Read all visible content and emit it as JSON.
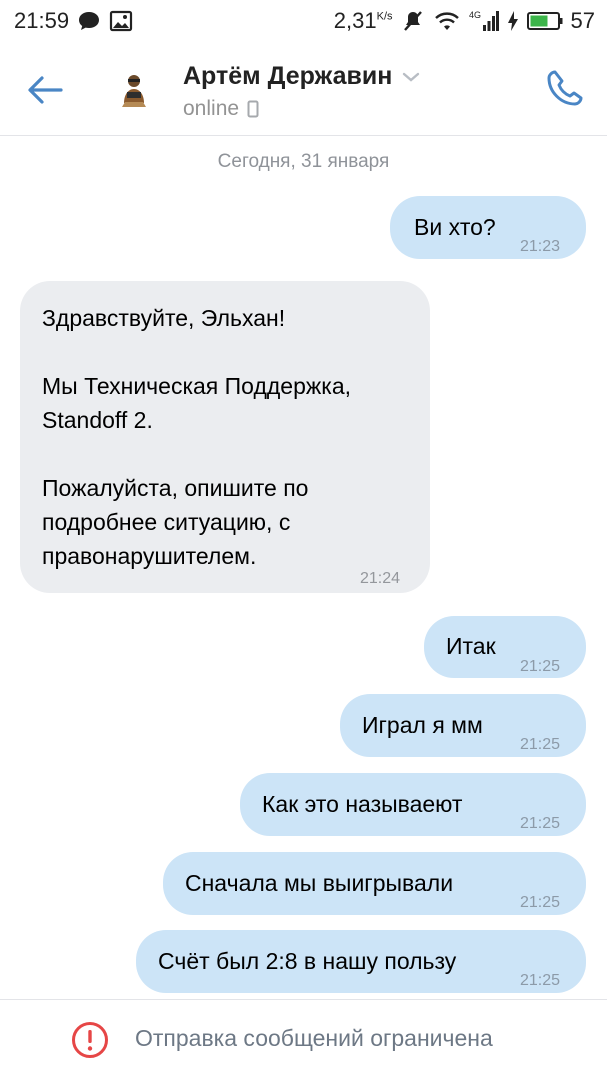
{
  "status_bar": {
    "time": "21:59",
    "speed": "2,31",
    "speed_unit": "K/s",
    "network": "4G",
    "battery": "57",
    "icons": [
      "chat-notification-icon",
      "image-notification-icon",
      "mute-icon",
      "wifi-icon",
      "signal-icon",
      "charging-icon",
      "battery-icon"
    ]
  },
  "header": {
    "contact_name": "Артём Державин",
    "status": "online",
    "icons": [
      "back-arrow-icon",
      "avatar",
      "chevron-down-icon",
      "mobile-device-icon",
      "phone-icon"
    ]
  },
  "chat": {
    "date_separator": "Сегодня, 31 января",
    "messages": [
      {
        "direction": "out",
        "text": "Ви хто?",
        "time": "21:23"
      },
      {
        "direction": "in",
        "lines": [
          "Здравствуйте, Эльхан!",
          "",
          "Мы Техническая Поддержка,",
          "Standoff 2.",
          "",
          "Пожалуйста, опишите по",
          "подробнее ситуацию, с",
          "правонарушителем."
        ],
        "time": "21:24"
      },
      {
        "direction": "out",
        "text": "Итак",
        "time": "21:25"
      },
      {
        "direction": "out",
        "text": "Играл я мм",
        "time": "21:25"
      },
      {
        "direction": "out",
        "text": "Как это называеют",
        "time": "21:25"
      },
      {
        "direction": "out",
        "text": "Сначала мы выигрывали",
        "time": "21:25"
      },
      {
        "direction": "out",
        "text": "Счёт был 2:8 в нашу пользу",
        "time": "21:25"
      }
    ]
  },
  "footer": {
    "notice": "Отправка сообщений ограничена"
  },
  "colors": {
    "accent": "#4a86c5",
    "outgoing_bubble": "#cce4f7",
    "incoming_bubble": "#ebedf0",
    "warning": "#e64646"
  }
}
